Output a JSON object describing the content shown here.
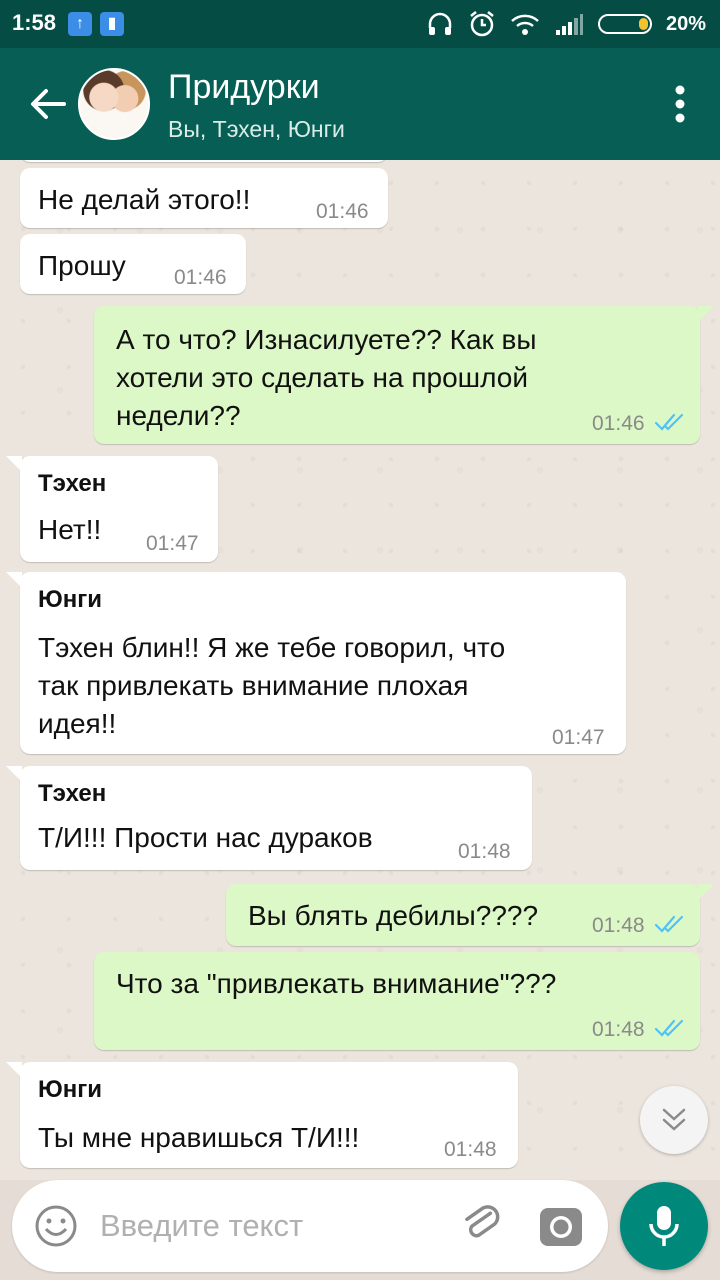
{
  "status_bar": {
    "time": "1:58",
    "battery_pct": "20%",
    "battery_level": 0.2
  },
  "header": {
    "title": "Придурки",
    "subtitle": "Вы, Тэхен, Юнги"
  },
  "messages": [
    {
      "text": "Не делай этого!!",
      "time": "01:46"
    },
    {
      "text": "Прошу",
      "time": "01:46"
    },
    {
      "lines": [
        "А то что? Изнасилуете?? Как вы",
        "хотели это сделать на прошлой",
        "недели??"
      ],
      "time": "01:46"
    },
    {
      "sender": "Тэхен",
      "text": "Нет!!",
      "time": "01:47"
    },
    {
      "sender": "Юнги",
      "lines": [
        "Тэхен блин!! Я же тебе говорил, что",
        "так привлекать внимание плохая",
        "идея!!"
      ],
      "time": "01:47"
    },
    {
      "sender": "Тэхен",
      "text": "Т/И!!! Прости нас дураков",
      "time": "01:48"
    },
    {
      "text": "Вы блять дебилы????",
      "time": "01:48"
    },
    {
      "text": "Что за \"привлекать внимание\"???",
      "time": "01:48"
    },
    {
      "sender": "Юнги",
      "text": "Ты мне нравишься Т/И!!!",
      "time": "01:48"
    }
  ],
  "input": {
    "placeholder": "Введите текст"
  },
  "icons": {
    "back": "arrow-left-icon",
    "menu": "more-vert-icon",
    "emoji": "emoji-icon",
    "attach": "paperclip-icon",
    "camera": "camera-icon",
    "mic": "mic-icon",
    "scroll": "double-chevron-down-icon",
    "read": "double-check-icon"
  },
  "colors": {
    "header": "#075e54",
    "status_bar": "#054d44",
    "outgoing": "#dcf8c6",
    "incoming": "#ffffff",
    "read_ticks": "#4fc3f7",
    "accent": "#00897b"
  }
}
